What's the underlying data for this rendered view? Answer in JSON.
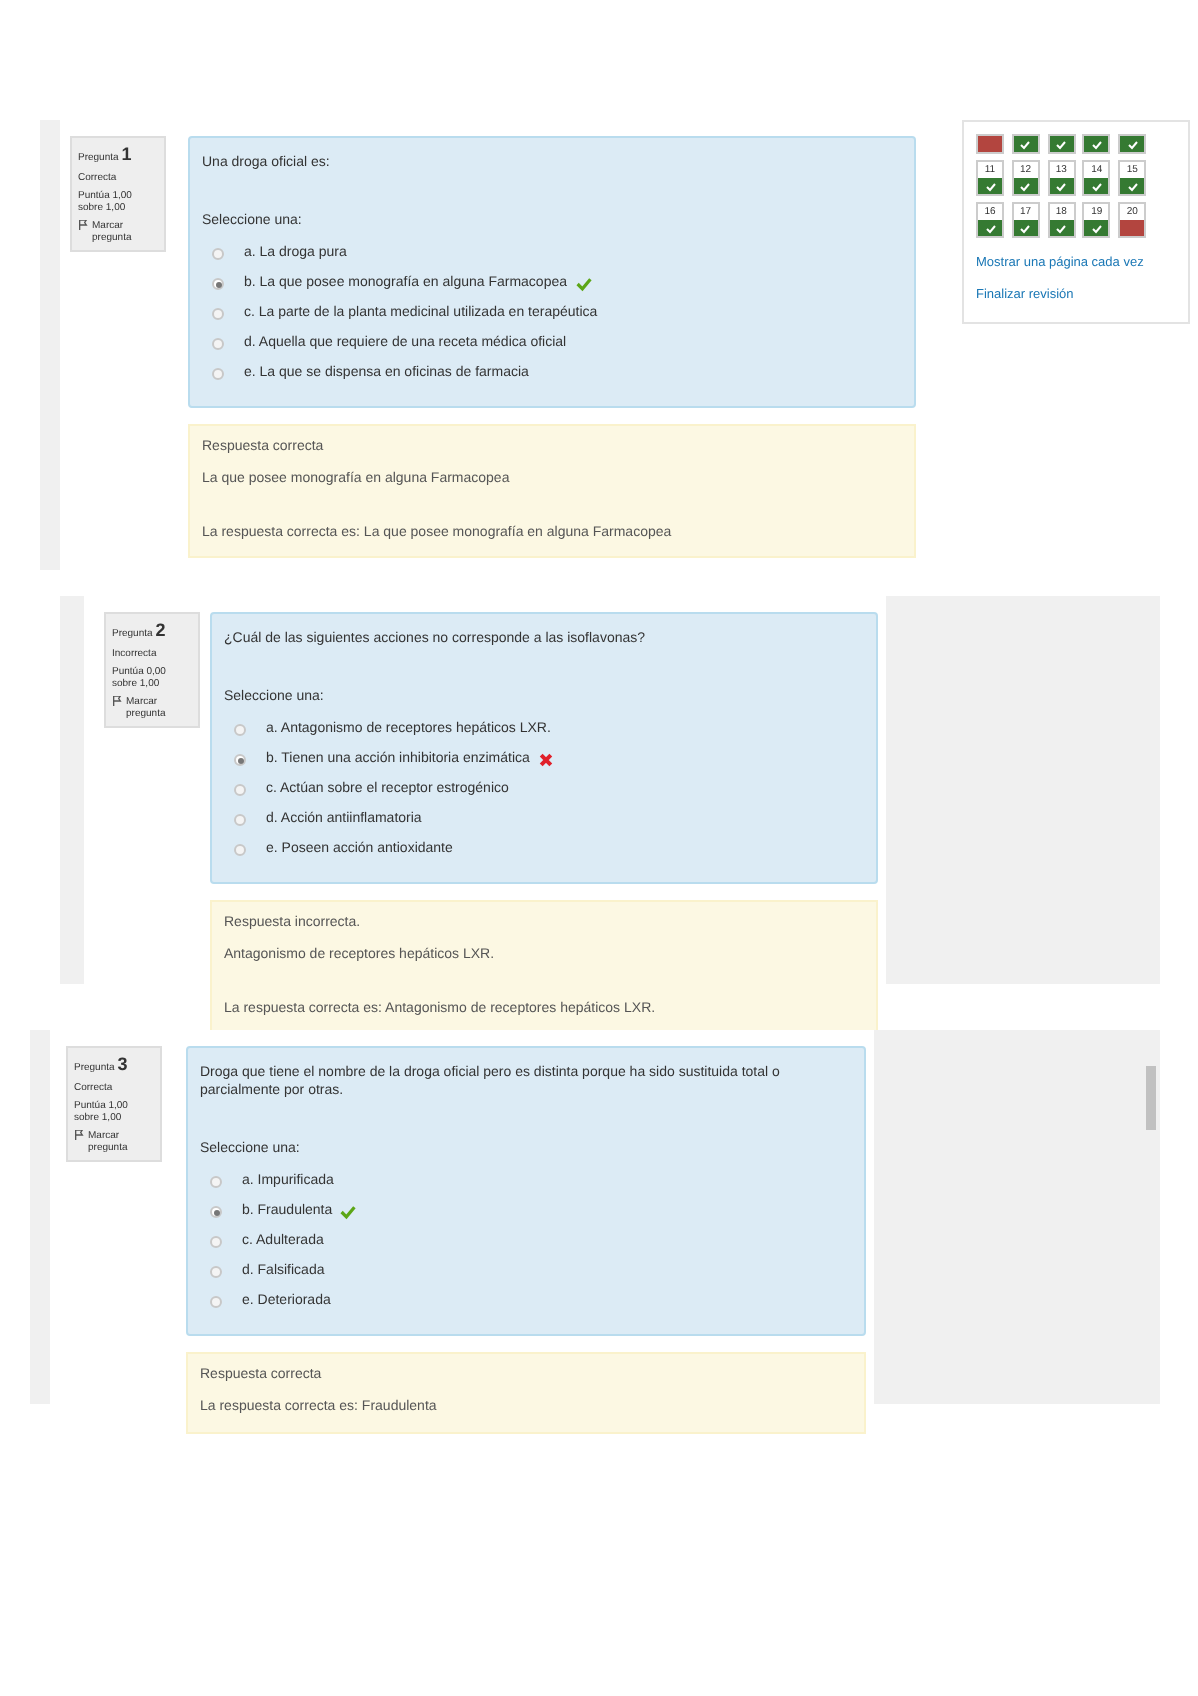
{
  "questions": [
    {
      "number": "1",
      "label": "Pregunta",
      "state": "Correcta",
      "score": "Puntúa 1,00 sobre 1,00",
      "flag": "Marcar pregunta",
      "text": "Una droga oficial es:",
      "prompt": "Seleccione una:",
      "options": [
        {
          "letter": "a.",
          "text": "La droga pura",
          "selected": false
        },
        {
          "letter": "b.",
          "text": "La que posee monografía en alguna Farmacopea",
          "selected": true,
          "correct": true
        },
        {
          "letter": "c.",
          "text": "La parte de la planta medicinal utilizada en terapéutica",
          "selected": false
        },
        {
          "letter": "d.",
          "text": "Aquella que requiere de una receta médica oficial",
          "selected": false
        },
        {
          "letter": "e.",
          "text": "La que se dispensa en oficinas de farmacia",
          "selected": false
        }
      ],
      "feedback": [
        "Respuesta correcta",
        "La que posee monografía en alguna Farmacopea",
        "La respuesta correcta es: La que posee monografía en alguna Farmacopea"
      ]
    },
    {
      "number": "2",
      "label": "Pregunta",
      "state": "Incorrecta",
      "score": "Puntúa 0,00 sobre 1,00",
      "flag": "Marcar pregunta",
      "text": "¿Cuál de las siguientes acciones no corresponde a las isoflavonas?",
      "prompt": "Seleccione una:",
      "options": [
        {
          "letter": "a.",
          "text": "Antagonismo de receptores hepáticos LXR.",
          "selected": false
        },
        {
          "letter": "b.",
          "text": "Tienen una acción inhibitoria enzimática",
          "selected": true,
          "correct": false
        },
        {
          "letter": "c.",
          "text": "Actúan sobre el receptor estrogénico",
          "selected": false
        },
        {
          "letter": "d.",
          "text": "Acción antiinflamatoria",
          "selected": false
        },
        {
          "letter": "e.",
          "text": "Poseen acción antioxidante",
          "selected": false
        }
      ],
      "feedback": [
        "Respuesta incorrecta.",
        "Antagonismo de receptores hepáticos LXR.",
        "La respuesta correcta es: Antagonismo de receptores hepáticos LXR."
      ]
    },
    {
      "number": "3",
      "label": "Pregunta",
      "state": "Correcta",
      "score": "Puntúa 1,00 sobre 1,00",
      "flag": "Marcar pregunta",
      "text": "Droga que tiene el nombre de la droga oficial pero es distinta porque ha sido sustituida total o parcialmente por otras.",
      "prompt": "Seleccione una:",
      "options": [
        {
          "letter": "a.",
          "text": "Impurificada",
          "selected": false
        },
        {
          "letter": "b.",
          "text": "Fraudulenta",
          "selected": true,
          "correct": true
        },
        {
          "letter": "c.",
          "text": "Adulterada",
          "selected": false
        },
        {
          "letter": "d.",
          "text": "Falsificada",
          "selected": false
        },
        {
          "letter": "e.",
          "text": "Deteriorada",
          "selected": false
        }
      ],
      "feedback": [
        "Respuesta correcta",
        "La respuesta correcta es: Fraudulenta"
      ]
    }
  ],
  "navigation": {
    "cells": [
      {
        "correct": false
      },
      {
        "correct": true
      },
      {
        "correct": true
      },
      {
        "correct": true
      },
      {
        "correct": true
      },
      {
        "number": "11",
        "correct": true
      },
      {
        "number": "12",
        "correct": true
      },
      {
        "number": "13",
        "correct": true
      },
      {
        "number": "14",
        "correct": true
      },
      {
        "number": "15",
        "correct": true
      },
      {
        "number": "16",
        "correct": true
      },
      {
        "number": "17",
        "correct": true
      },
      {
        "number": "18",
        "correct": true
      },
      {
        "number": "19",
        "correct": true
      },
      {
        "number": "20",
        "correct": false
      }
    ],
    "links": [
      "Mostrar una página cada vez",
      "Finalizar revisión"
    ]
  }
}
